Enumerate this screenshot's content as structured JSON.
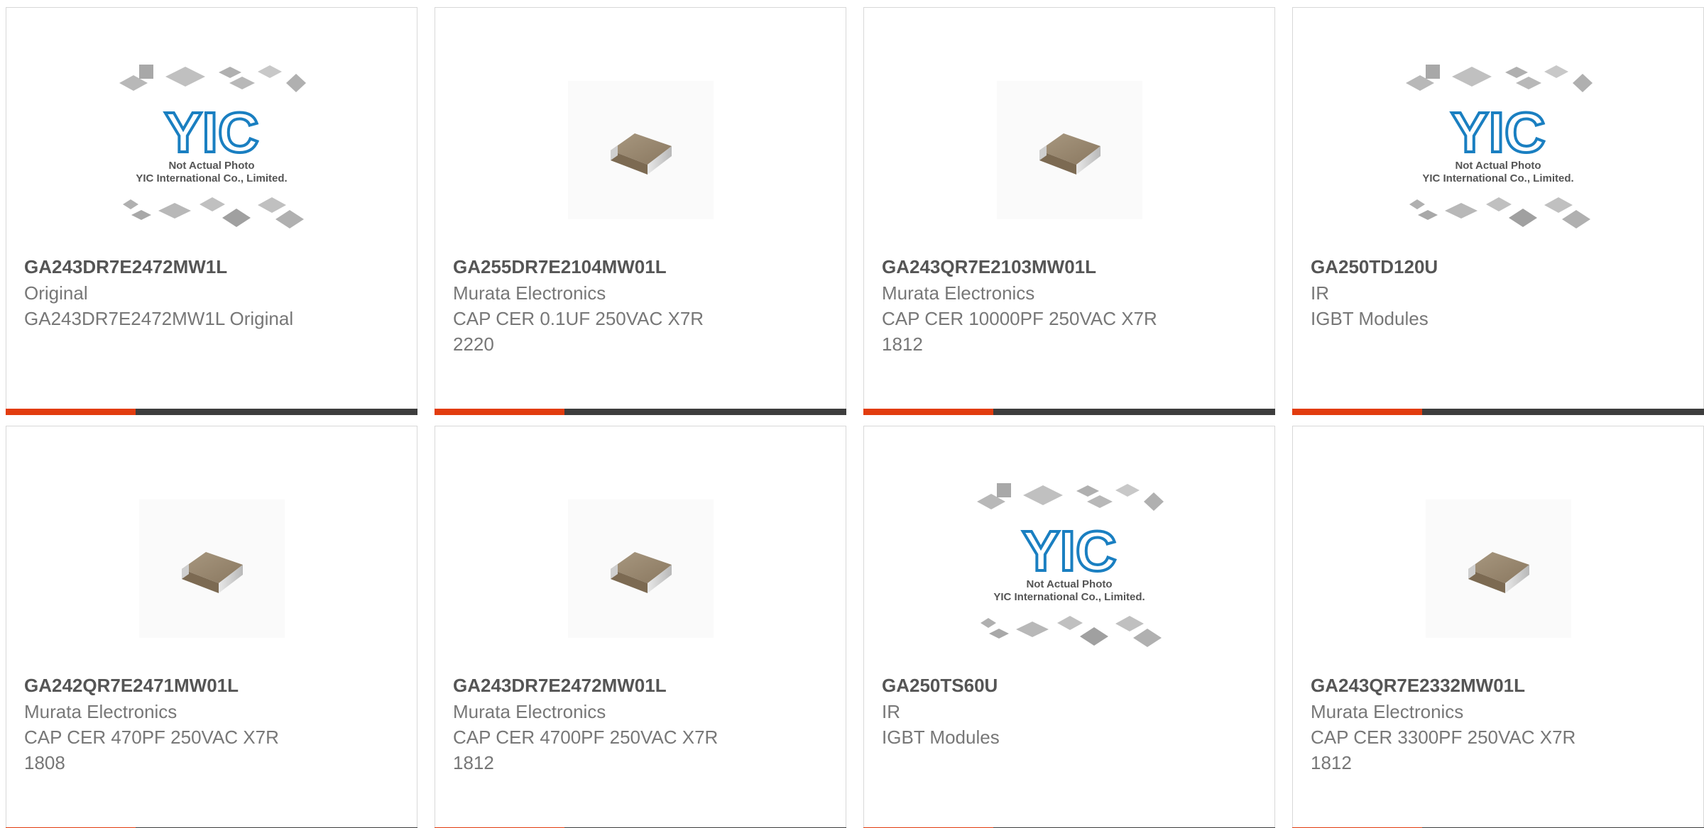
{
  "products": [
    {
      "part": "GA243DR7E2472MW1L",
      "manufacturer": "Original",
      "description": "GA243DR7E2472MW1L Original",
      "image": "not-actual-photo"
    },
    {
      "part": "GA255DR7E2104MW01L",
      "manufacturer": "Murata Electronics",
      "description": "CAP CER 0.1UF 250VAC X7R\n2220",
      "image": "ceramic-capacitor-photo"
    },
    {
      "part": "GA243QR7E2103MW01L",
      "manufacturer": "Murata Electronics",
      "description": "CAP CER 10000PF 250VAC X7R\n1812",
      "image": "ceramic-capacitor-photo"
    },
    {
      "part": "GA250TD120U",
      "manufacturer": "IR",
      "description": "IGBT Modules",
      "image": "not-actual-photo"
    },
    {
      "part": "GA242QR7E2471MW01L",
      "manufacturer": "Murata Electronics",
      "description": "CAP CER 470PF 250VAC X7R\n1808",
      "image": "ceramic-capacitor-photo"
    },
    {
      "part": "GA243DR7E2472MW01L",
      "manufacturer": "Murata Electronics",
      "description": "CAP CER 4700PF 250VAC X7R\n1812",
      "image": "ceramic-capacitor-photo"
    },
    {
      "part": "GA250TS60U",
      "manufacturer": "IR",
      "description": "IGBT Modules",
      "image": "not-actual-photo"
    },
    {
      "part": "GA243QR7E2332MW01L",
      "manufacturer": "Murata Electronics",
      "description": "CAP CER 3300PF 250VAC X7R\n1812",
      "image": "ceramic-capacitor-photo"
    }
  ],
  "placeholder": {
    "logo_text": "YIC",
    "line1": "Not Actual Photo",
    "line2": "YIC International Co., Limited."
  },
  "colors": {
    "accent": "#e23c0f",
    "bar": "#3d3d3d",
    "logo_blue": "#1a7fc1"
  }
}
